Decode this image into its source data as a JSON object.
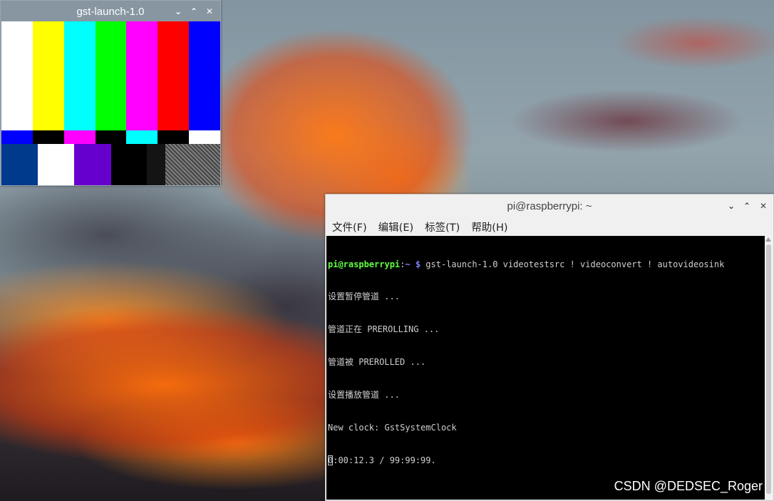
{
  "gst_window": {
    "title": "gst-launch-1.0",
    "controls": {
      "minimize": "⌄",
      "maximize": "⌃",
      "close": "✕"
    }
  },
  "test_pattern": {
    "top_bars": [
      "#ffffff",
      "#ffff00",
      "#00ffff",
      "#00ff00",
      "#ff00ff",
      "#ff0000",
      "#0000ff"
    ],
    "mid_bars": [
      "#0000ff",
      "#000000",
      "#ff00ff",
      "#000000",
      "#00ffff",
      "#000000",
      "#ffffff"
    ],
    "bottom_blocks": [
      "#003a8c",
      "#ffffff",
      "#6600cc",
      "#000000",
      "#000000",
      "#141414"
    ]
  },
  "terminal_window": {
    "title": "pi@raspberrypi: ~",
    "controls": {
      "minimize": "⌄",
      "maximize": "⌃",
      "close": "✕"
    },
    "menu": [
      "文件(F)",
      "编辑(E)",
      "标签(T)",
      "帮助(H)"
    ],
    "prompt_user": "pi@raspberrypi",
    "prompt_sep": ":",
    "prompt_path": "~ $",
    "command": " gst-launch-1.0 videotestsrc ! videoconvert ! autovideosink",
    "output_lines": [
      "设置暂停管道 ...",
      "管道正在 PREROLLING ...",
      "管道被 PREROLLED ...",
      "设置播放管道 ...",
      "New clock: GstSystemClock"
    ],
    "status_first_char": "0",
    "status_rest": ":00:12.3 / 99:99:99."
  },
  "watermark": "CSDN @DEDSEC_Roger"
}
